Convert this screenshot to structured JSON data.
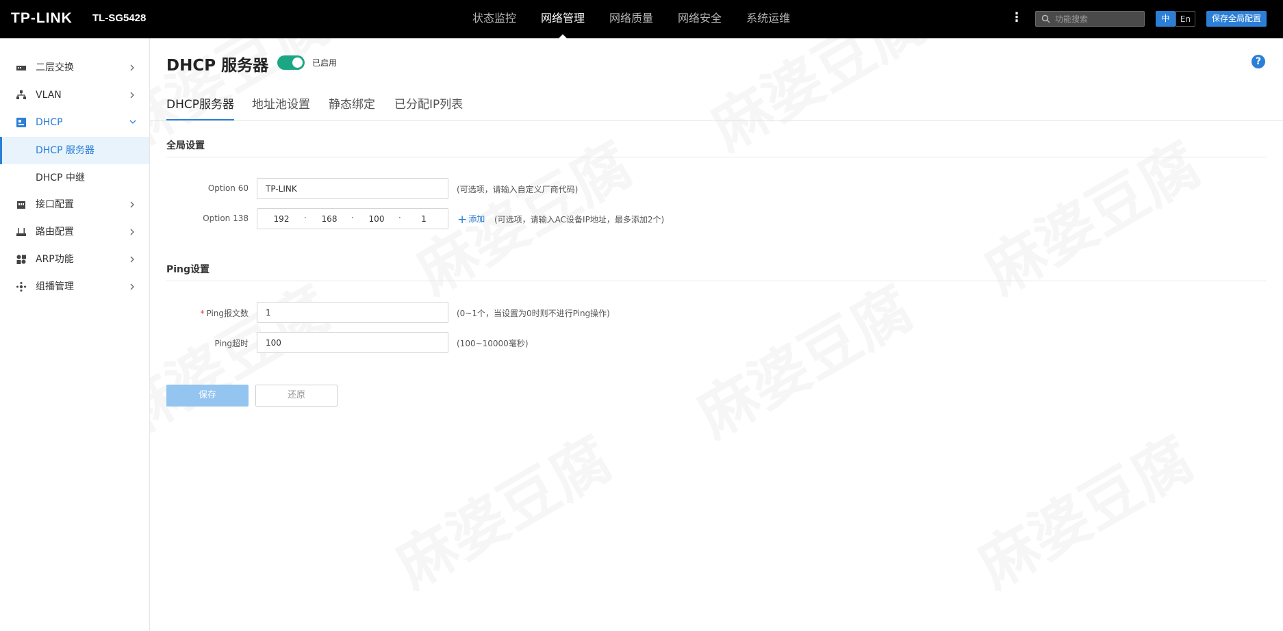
{
  "header": {
    "logo": "TP-LINK",
    "model": "TL-SG5428",
    "nav": [
      "状态监控",
      "网络管理",
      "网络质量",
      "网络安全",
      "系统运维"
    ],
    "active_nav": 1,
    "search_placeholder": "功能搜索",
    "lang_zh": "中",
    "lang_en": "En",
    "save_all": "保存全局配置"
  },
  "sidebar": {
    "items": [
      {
        "label": "二层交换",
        "icon": "switch-icon"
      },
      {
        "label": "VLAN",
        "icon": "vlan-icon"
      },
      {
        "label": "DHCP",
        "icon": "dhcp-icon",
        "expanded": true,
        "children": [
          {
            "label": "DHCP 服务器",
            "active": true
          },
          {
            "label": "DHCP 中继"
          }
        ]
      },
      {
        "label": "接口配置",
        "icon": "interface-icon"
      },
      {
        "label": "路由配置",
        "icon": "router-icon"
      },
      {
        "label": "ARP功能",
        "icon": "arp-icon"
      },
      {
        "label": "组播管理",
        "icon": "multicast-icon"
      }
    ]
  },
  "page": {
    "title": "DHCP 服务器",
    "toggle_enabled": true,
    "toggle_label": "已启用",
    "help": "?"
  },
  "tabs": [
    "DHCP服务器",
    "地址池设置",
    "静态绑定",
    "已分配IP列表"
  ],
  "global_settings": {
    "title": "全局设置",
    "option60": {
      "label": "Option 60",
      "value": "TP-LINK",
      "hint": "(可选项，请输入自定义厂商代码)"
    },
    "option138": {
      "label": "Option 138",
      "ip": [
        "192",
        "168",
        "100",
        "1"
      ],
      "dot": "·",
      "add": "添加",
      "hint": "(可选项，请输入AC设备IP地址，最多添加2个)"
    }
  },
  "ping_settings": {
    "title": "Ping设置",
    "count": {
      "required_mark": "*",
      "label": "Ping报文数",
      "value": "1",
      "hint": "(0~1个，当设置为0时则不进行Ping操作)"
    },
    "timeout": {
      "label": "Ping超时",
      "value": "100",
      "hint": "(100~10000毫秒)"
    }
  },
  "buttons": {
    "save": "保存",
    "reset": "还原"
  },
  "watermark": "麻婆豆腐",
  "colors": {
    "accent": "#2b7fd6",
    "toggle": "#1ba784",
    "topbar": "#000000"
  }
}
